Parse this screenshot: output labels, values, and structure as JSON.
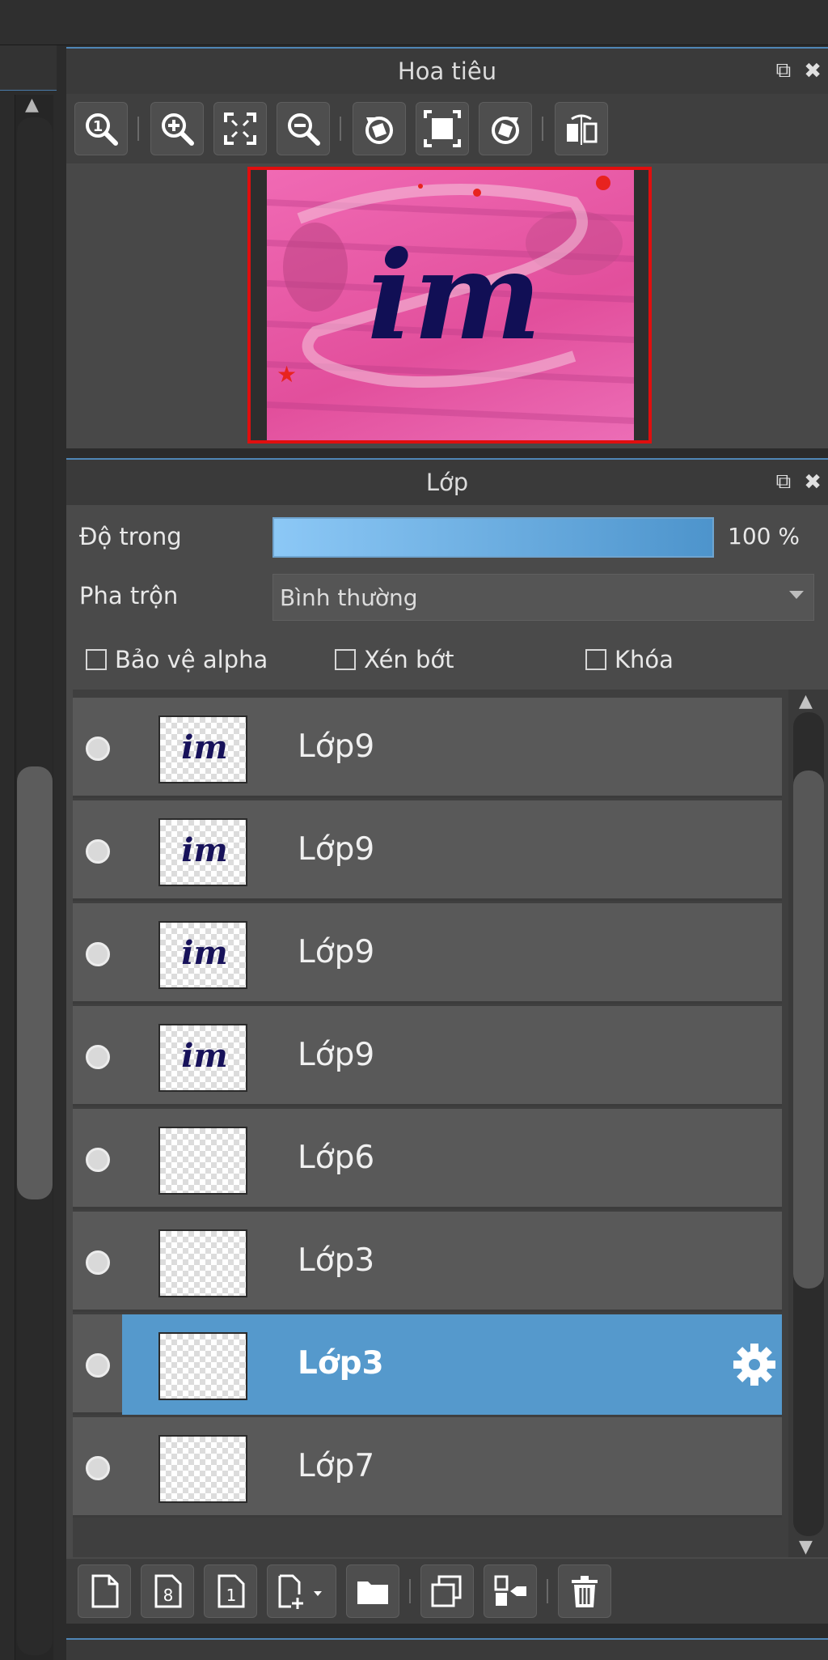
{
  "navigator": {
    "title": "Hoa tiêu",
    "toolbar": [
      "zoom-actual-icon",
      "zoom-in-icon",
      "fit-screen-icon",
      "zoom-out-icon",
      "rotate-left-icon",
      "fit-frame-icon",
      "rotate-right-icon",
      "flip-horizontal-icon"
    ],
    "preview_text": "im"
  },
  "layers": {
    "title": "Lớp",
    "opacity_label": "Độ trong",
    "opacity_value": "100 %",
    "opacity_fraction": 1.0,
    "blend_label": "Pha trộn",
    "blend_value": "Bình thường",
    "protect_alpha": "Bảo vệ alpha",
    "clipping": "Xén bớt",
    "lock": "Khóa",
    "items": [
      {
        "name": "Lớp9",
        "thumb": "im"
      },
      {
        "name": "Lớp9",
        "thumb": "im"
      },
      {
        "name": "Lớp9",
        "thumb": "im"
      },
      {
        "name": "Lớp9",
        "thumb": "im"
      },
      {
        "name": "Lớp6",
        "thumb": ""
      },
      {
        "name": "Lớp3",
        "thumb": ""
      },
      {
        "name": "Lớp3",
        "thumb": ""
      },
      {
        "name": "Lớp7",
        "thumb": ""
      }
    ],
    "selected_index": 6,
    "toolbar": [
      "new-layer-icon",
      "new-8bit-layer-icon",
      "new-1bit-layer-icon",
      "add-layer-menu-icon",
      "folder-icon",
      "duplicate-icon",
      "merge-down-icon",
      "trash-icon"
    ]
  },
  "colors": {
    "accent": "#5599cc",
    "panel": "#4a4a4a",
    "header": "#3a3a3a"
  }
}
